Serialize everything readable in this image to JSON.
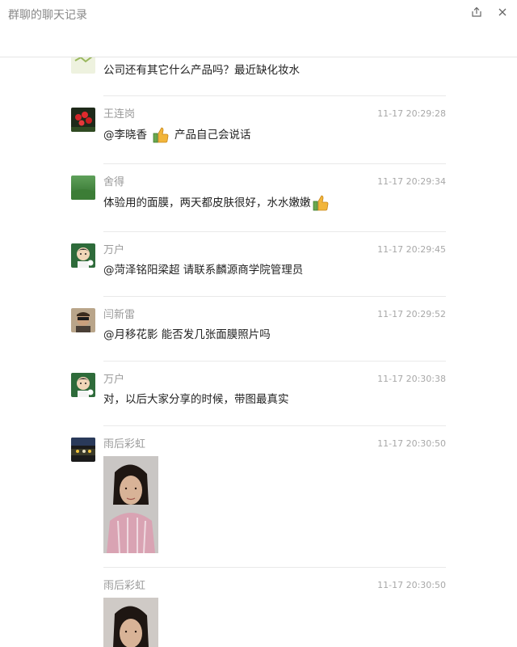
{
  "window": {
    "title": "群聊的聊天记录"
  },
  "messages": [
    {
      "sender": "",
      "time": "",
      "text": "公司还有其它什么产品吗？最近缺化妆水"
    },
    {
      "sender": "王连岗",
      "time": "11-17 20:29:28",
      "text_before": "@李晓香",
      "text_after": "产品自己会说话"
    },
    {
      "sender": "舍得",
      "time": "11-17 20:29:34",
      "text": "体验用的面膜，两天都皮肤很好，水水嫩嫩"
    },
    {
      "sender": "万户",
      "time": "11-17 20:29:45",
      "text": "@菏泽铭阳梁超 请联系麟源商学院管理员"
    },
    {
      "sender": "闫新雷",
      "time": "11-17 20:29:52",
      "text": "@月移花影 能否发几张面膜照片吗"
    },
    {
      "sender": "万户",
      "time": "11-17 20:30:38",
      "text": "对，以后大家分享的时候，带图最真实"
    },
    {
      "sender": "雨后彩虹",
      "time": "11-17 20:30:50"
    },
    {
      "sender": "雨后彩虹",
      "time": "11-17 20:30:50"
    }
  ]
}
